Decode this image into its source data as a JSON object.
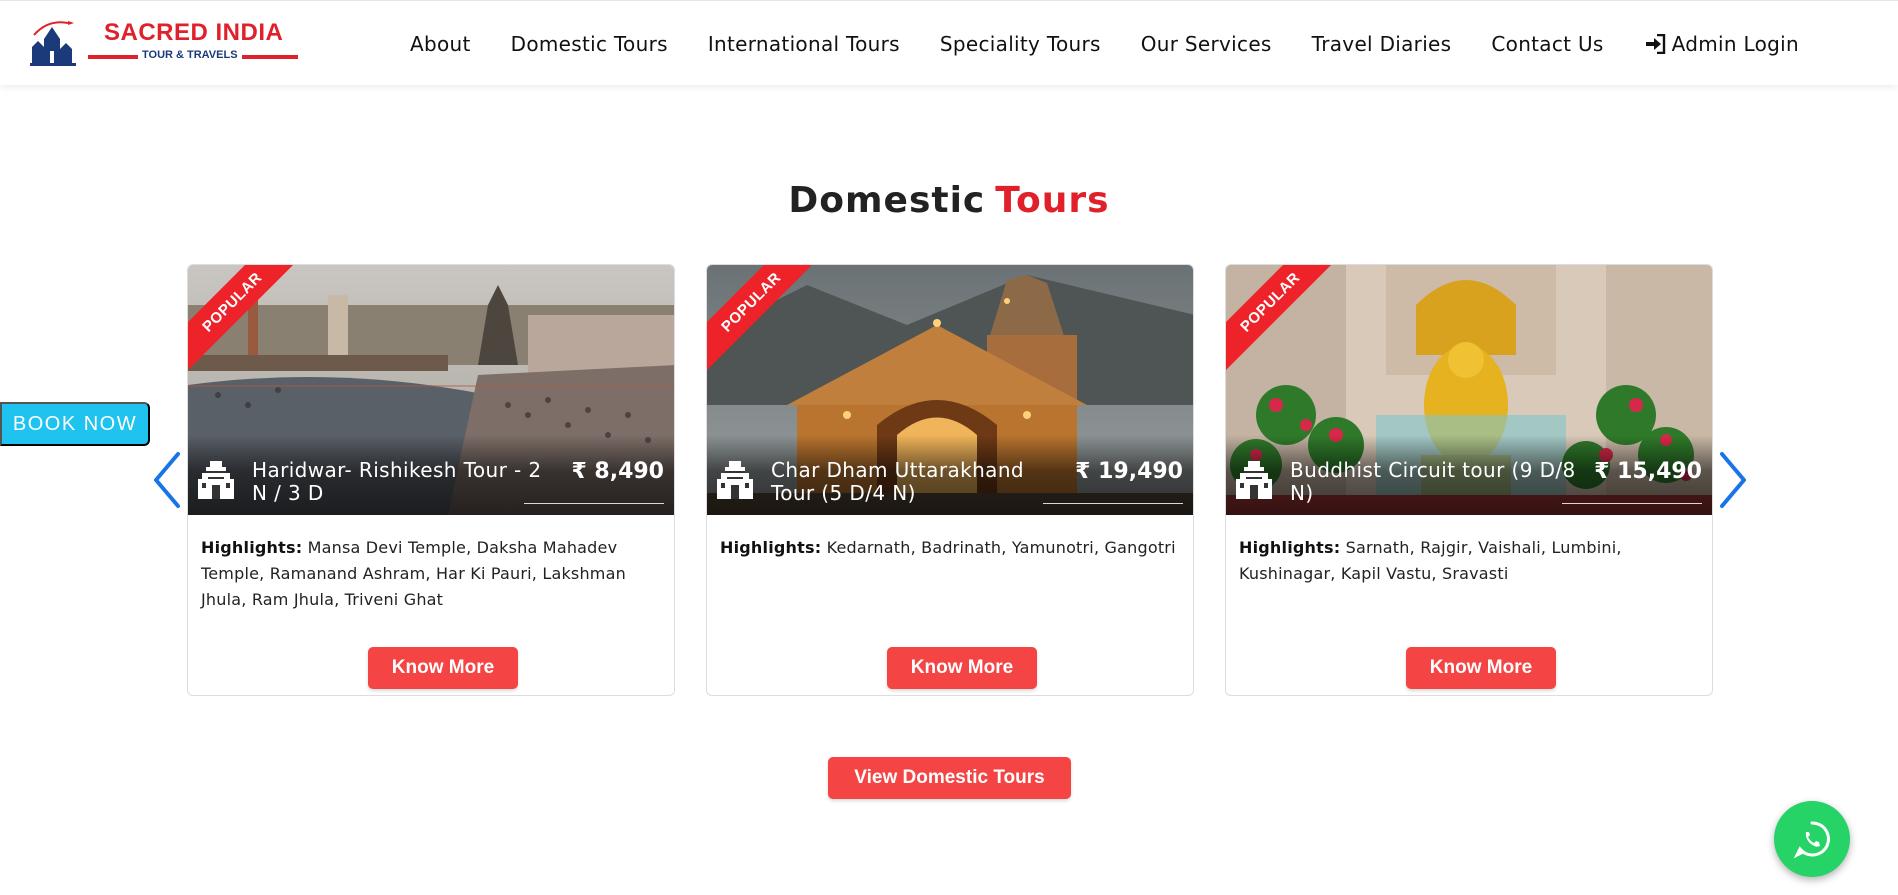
{
  "brand": {
    "name": "SACRED INDIA",
    "tagline": "TOUR & TRAVELS",
    "primary_color": "#e0202a",
    "secondary_color": "#1a3a7a"
  },
  "nav": {
    "items": [
      "About",
      "Domestic Tours",
      "International Tours",
      "Speciality Tours",
      "Our Services",
      "Travel Diaries",
      "Contact Us"
    ],
    "admin_login": "Admin Login",
    "admin_icon": "sign-in-icon"
  },
  "section": {
    "title_part1": "Domestic",
    "title_part2": "Tours"
  },
  "book_now": "BOOK NOW",
  "cards": [
    {
      "badge": "POPULAR",
      "title": "Haridwar- Rishikesh Tour - 2 N / 3 D",
      "price": "₹ 8,490",
      "highlights_label": "Highlights:",
      "highlights": "Mansa Devi Temple, Daksha Mahadev Temple, Ramanand Ashram, Har Ki Pauri, Lakshman Jhula, Ram Jhula, Triveni Ghat",
      "button": "Know More"
    },
    {
      "badge": "POPULAR",
      "title": "Char Dham Uttarakhand Tour (5 D/4 N)",
      "price": "₹ 19,490",
      "highlights_label": "Highlights:",
      "highlights": "Kedarnath, Badrinath, Yamunotri, Gangotri",
      "button": "Know More"
    },
    {
      "badge": "POPULAR",
      "title": "Buddhist Circuit tour (9 D/8 N)",
      "price": "₹ 15,490",
      "highlights_label": "Highlights:",
      "highlights": "Sarnath, Rajgir, Vaishali, Lumbini, Kushinagar, Kapil Vastu, Sravasti",
      "button": "Know More"
    }
  ],
  "view_all": "View Domestic Tours",
  "colors": {
    "accent_red": "#f44444",
    "ribbon_red": "#ee2229",
    "book_now_bg": "#1ec3f0",
    "arrow_blue": "#1a73e8",
    "whatsapp_green": "#25d366"
  }
}
